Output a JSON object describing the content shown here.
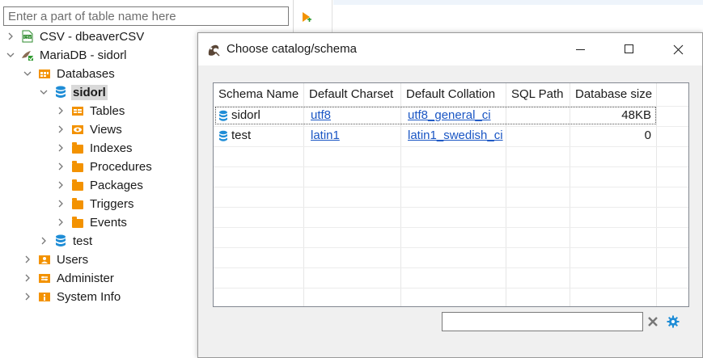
{
  "navigator": {
    "filter_placeholder": "Enter a part of table name here",
    "tree": [
      {
        "label": "CSV - dbeaverCSV",
        "expanded": false,
        "icon": "csv-file-icon"
      },
      {
        "label": "MariaDB - sidorl",
        "expanded": true,
        "icon": "mariadb-icon"
      },
      {
        "label": "Databases",
        "expanded": true,
        "icon": "databases-folder-icon"
      },
      {
        "label": "sidorl",
        "expanded": true,
        "icon": "database-icon",
        "selected": true
      },
      {
        "label": "Tables",
        "icon": "tables-icon"
      },
      {
        "label": "Views",
        "icon": "views-icon"
      },
      {
        "label": "Indexes",
        "icon": "folder-icon"
      },
      {
        "label": "Procedures",
        "icon": "folder-icon"
      },
      {
        "label": "Packages",
        "icon": "folder-icon"
      },
      {
        "label": "Triggers",
        "icon": "folder-icon"
      },
      {
        "label": "Events",
        "icon": "folder-icon"
      },
      {
        "label": "test",
        "expanded": false,
        "icon": "database-icon"
      },
      {
        "label": "Users",
        "expanded": false,
        "icon": "users-icon"
      },
      {
        "label": "Administer",
        "expanded": false,
        "icon": "administer-icon"
      },
      {
        "label": "System Info",
        "expanded": false,
        "icon": "info-icon"
      }
    ]
  },
  "dialog": {
    "title": "Choose catalog/schema",
    "columns": [
      "Schema Name",
      "Default Charset",
      "Default Collation",
      "SQL Path",
      "Database size"
    ],
    "rows": [
      {
        "schema": "sidorl",
        "charset": "utf8",
        "collation": "utf8_general_ci",
        "sql_path": "",
        "size": "48KB"
      },
      {
        "schema": "test",
        "charset": "latin1",
        "collation": "latin1_swedish_ci",
        "sql_path": "",
        "size": "0"
      }
    ],
    "filter_value": ""
  },
  "colors": {
    "accent": "#1a56c4",
    "folder": "#f39200",
    "database": "#1f8dd6",
    "selection": "#d9d9d9"
  }
}
